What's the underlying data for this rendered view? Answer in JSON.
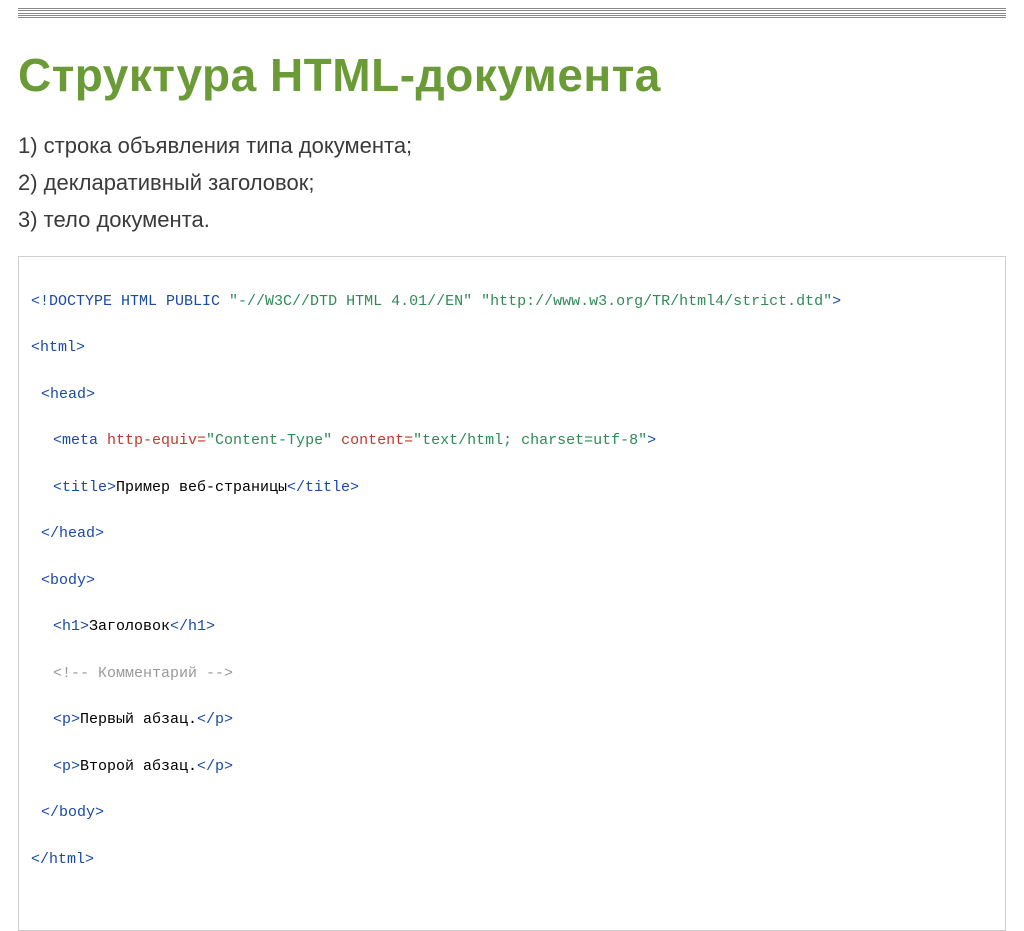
{
  "title": "Структура HTML-документа",
  "list": {
    "item1": "1) строка объявления типа документа;",
    "item2": "2) декларативный заголовок;",
    "item3": "3) тело документа."
  },
  "code": {
    "l1_tag": "<!DOCTYPE HTML PUBLIC ",
    "l1_val": "\"-//W3C//DTD HTML 4.01//EN\" \"http://www.w3.org/TR/html4/strict.dtd\"",
    "l1_end": ">",
    "l2": "<html>",
    "l3": "<head>",
    "l4_tag": "<meta",
    "l4_a1n": " http-equiv=",
    "l4_a1v": "\"Content-Type\"",
    "l4_a2n": " content=",
    "l4_a2v": "\"text/html; charset=utf-8\"",
    "l4_end": ">",
    "l5_open": "<title>",
    "l5_txt": "Пример веб-страницы",
    "l5_close": "</title>",
    "l6": "</head>",
    "l7": "<body>",
    "l8_open": "<h1>",
    "l8_txt": "Заголовок",
    "l8_close": "</h1>",
    "l9": "<!-- Комментарий -->",
    "l10_open": "<p>",
    "l10_txt": "Первый абзац.",
    "l10_close": "</p>",
    "l11_open": "<p>",
    "l11_txt": "Второй абзац.",
    "l11_close": "</p>",
    "l12": "</body>",
    "l13": "</html>"
  }
}
